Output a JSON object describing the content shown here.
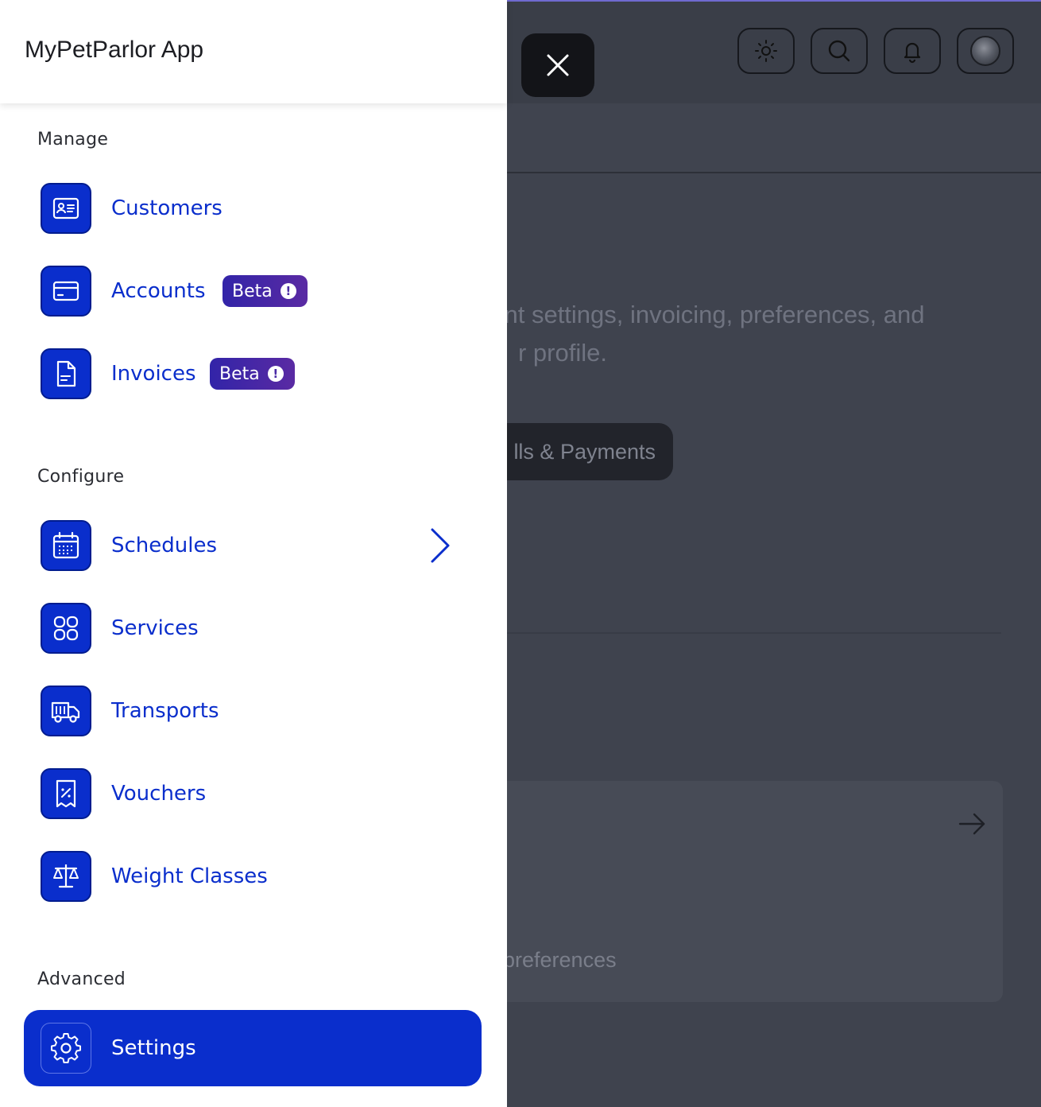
{
  "app": {
    "title": "MyPetParlor App"
  },
  "header_actions": [
    {
      "name": "theme-toggle-button",
      "icon": "sun-icon"
    },
    {
      "name": "search-button",
      "icon": "search-icon"
    },
    {
      "name": "notifications-button",
      "icon": "bell-icon"
    },
    {
      "name": "profile-avatar-button",
      "icon": "avatar"
    }
  ],
  "background": {
    "description_line1": "ount settings, invoicing, preferences, and",
    "description_line2": "r profile.",
    "pill_label": "lls & Payments",
    "card_text": "preferences"
  },
  "sections": [
    {
      "label": "Manage",
      "items": [
        {
          "label": "Customers",
          "icon": "id-card-icon"
        },
        {
          "label": "Accounts",
          "icon": "credit-card-icon",
          "badge": "Beta"
        },
        {
          "label": "Invoices",
          "icon": "document-icon",
          "badge": "Beta"
        }
      ]
    },
    {
      "label": "Configure",
      "items": [
        {
          "label": "Schedules",
          "icon": "calendar-icon",
          "has_submenu": true
        },
        {
          "label": "Services",
          "icon": "grid-icon"
        },
        {
          "label": "Transports",
          "icon": "truck-icon"
        },
        {
          "label": "Vouchers",
          "icon": "receipt-percent-icon"
        },
        {
          "label": "Weight Classes",
          "icon": "scale-icon"
        }
      ]
    },
    {
      "label": "Advanced",
      "items": [
        {
          "label": "Settings",
          "icon": "gear-icon",
          "active": true
        }
      ]
    }
  ],
  "colors": {
    "accent": "#0a2ecc",
    "badge_gradient_start": "#3224a8",
    "badge_gradient_end": "#5a2aa3",
    "overlay": "#3f434e"
  }
}
